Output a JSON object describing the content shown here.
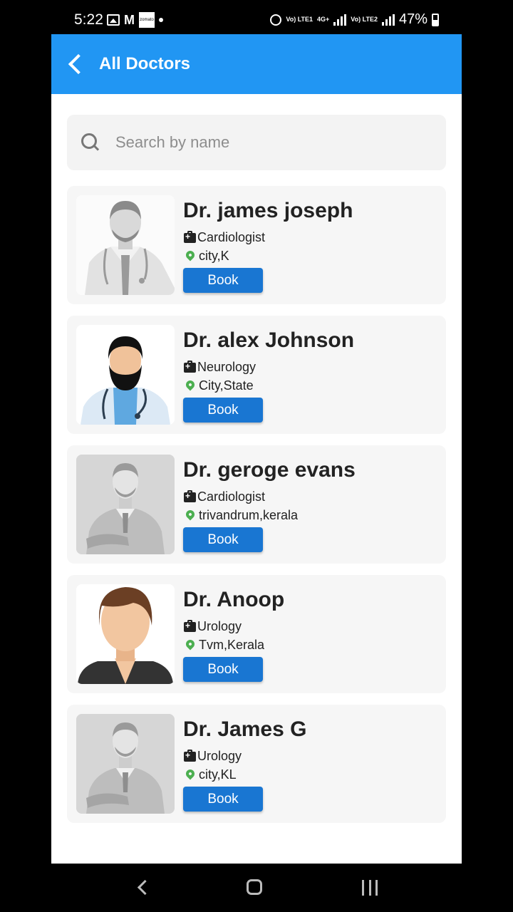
{
  "status_bar": {
    "time": "5:22",
    "zomato_label": "zomato",
    "volte1": "Vo) LTE1",
    "net_type": "4G+",
    "volte2": "Vo) LTE2",
    "battery": "47%"
  },
  "appbar": {
    "title": "All Doctors"
  },
  "search": {
    "placeholder": "Search by name",
    "value": ""
  },
  "doctors": [
    {
      "name": "Dr. james joseph",
      "specialty": "Cardiologist",
      "location": "city,K",
      "book_label": "Book"
    },
    {
      "name": "Dr. alex Johnson",
      "specialty": "Neurology",
      "location": "City,State",
      "book_label": "Book"
    },
    {
      "name": "Dr. geroge evans",
      "specialty": "Cardiologist",
      "location": "trivandrum,kerala",
      "book_label": "Book"
    },
    {
      "name": "Dr. Anoop",
      "specialty": "Urology",
      "location": "Tvm,Kerala",
      "book_label": "Book"
    },
    {
      "name": "Dr. James G",
      "specialty": "Urology",
      "location": "city,KL",
      "book_label": "Book"
    }
  ],
  "colors": {
    "appbar": "#2196F3",
    "book_button": "#1976D2",
    "location_pin": "#4CAF50",
    "card_bg": "#f6f6f6"
  },
  "icons": [
    "back-arrow-icon",
    "search-icon",
    "medical-bag-icon",
    "location-pin-icon",
    "nav-back-icon",
    "nav-home-icon",
    "nav-recents-icon"
  ]
}
